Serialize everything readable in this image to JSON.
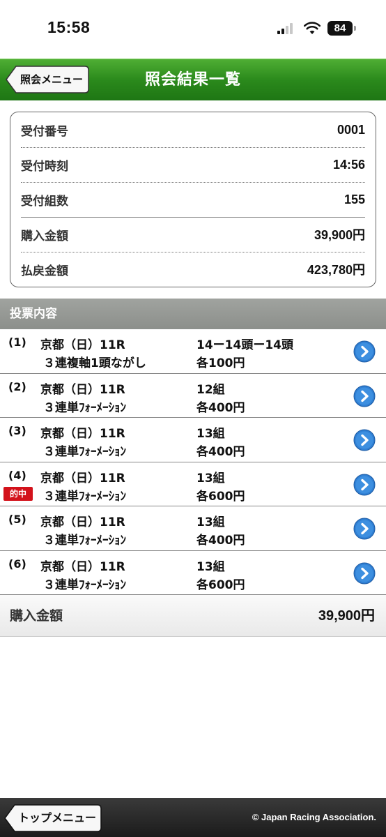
{
  "status_bar": {
    "time": "15:58",
    "battery": "84"
  },
  "header": {
    "back_label": "照会メニュー",
    "title": "照会結果一覧"
  },
  "summary": {
    "rows": [
      {
        "label": "受付番号",
        "value": "0001"
      },
      {
        "label": "受付時刻",
        "value": "14:56"
      },
      {
        "label": "受付組数",
        "value": "155"
      },
      {
        "label": "購入金額",
        "value": "39,900円"
      },
      {
        "label": "払戻金額",
        "value": "423,780円"
      }
    ]
  },
  "section": {
    "title": "投票内容"
  },
  "bets": [
    {
      "num": "(1)",
      "race": "京都（日）11R",
      "type": "３連複軸1頭ながし",
      "detail": "14ー14頭ー14頭",
      "amount": "各100円",
      "hit": false
    },
    {
      "num": "(2)",
      "race": "京都（日）11R",
      "type": "３連単ﾌｫｰﾒｰｼｮﾝ",
      "detail": "12組",
      "amount": "各400円",
      "hit": false
    },
    {
      "num": "(3)",
      "race": "京都（日）11R",
      "type": "３連単ﾌｫｰﾒｰｼｮﾝ",
      "detail": "13組",
      "amount": "各400円",
      "hit": false
    },
    {
      "num": "(4)",
      "race": "京都（日）11R",
      "type": "３連単ﾌｫｰﾒｰｼｮﾝ",
      "detail": "13組",
      "amount": "各600円",
      "hit": true,
      "hit_label": "的中"
    },
    {
      "num": "(5)",
      "race": "京都（日）11R",
      "type": "３連単ﾌｫｰﾒｰｼｮﾝ",
      "detail": "13組",
      "amount": "各400円",
      "hit": false
    },
    {
      "num": "(6)",
      "race": "京都（日）11R",
      "type": "３連単ﾌｫｰﾒｰｼｮﾝ",
      "detail": "13組",
      "amount": "各600円",
      "hit": false
    }
  ],
  "total": {
    "label": "購入金額",
    "value": "39,900円"
  },
  "footer": {
    "top_label": "トップメニュー",
    "copyright": "© Japan Racing Association."
  },
  "icons": {
    "row_arrow": "chevron-right-circle-icon"
  },
  "colors": {
    "header_green": "#2b8a1c",
    "arrow_blue": "#2f7fd3",
    "hit_red": "#d3121b"
  }
}
